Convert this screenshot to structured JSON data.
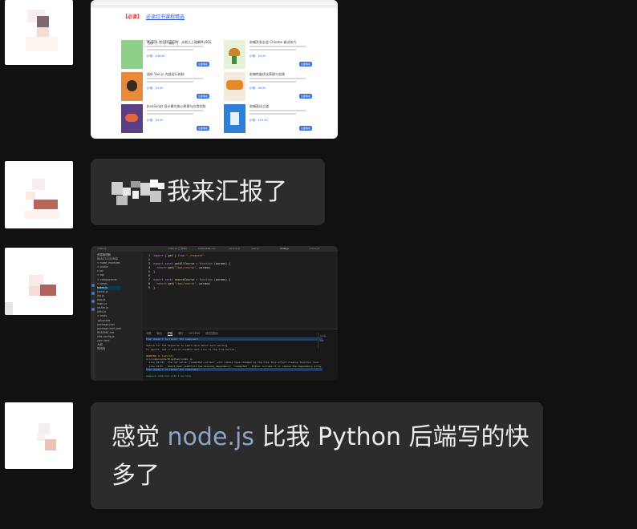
{
  "messages": [
    {
      "id": "msg1",
      "type": "image",
      "content": {
        "kind": "browser-course-list",
        "header_logo": "【必读】",
        "header_title": "必读红书课程精选",
        "filters": [
          "推荐",
          "全部",
          "课程"
        ],
        "courses": [
          {
            "title": "MySQL 是怎样运行的：从根儿上理解MySQL",
            "price": "价格：¥46.80"
          },
          {
            "title": "前端开发必会 Chrome 调试技巧",
            "price": "价格：¥9.90"
          },
          {
            "title": "剖析 Vue.js 内部运行机制",
            "price": "价格：¥4.90"
          },
          {
            "title": "前端性能优化原理与实践",
            "price": "价格：¥6.90"
          },
          {
            "title": "JavaScript 设计模式核心原理与应用实践",
            "price": "价格：¥9.90"
          },
          {
            "title": "前端面试之道",
            "price": "价格：¥19.90"
          }
        ],
        "button_label": "立即购买"
      }
    },
    {
      "id": "msg2",
      "type": "text",
      "text": "我来汇报了"
    },
    {
      "id": "msg3",
      "type": "image",
      "content": {
        "kind": "code-editor",
        "tabs": [
          "index.js",
          "index.js (工作树)",
          "EXPLORER.md",
          "service.js",
          "user.js",
          "node.js",
          "course.js"
        ],
        "tree": [
          "资源管理器",
          "REACT-COURSE",
          "> node_modules",
          "> public",
          "v src",
          "  > api",
          "  > components",
          "  v views",
          "    index.js",
          "    home.js",
          "    list.js",
          "  App.js",
          "  main.js",
          "  router.js",
          "  utils.js",
          "> tests",
          ".gitignore",
          "package.json",
          "package-lock.json",
          "README.md",
          "vite.config.js",
          "yarn.lock",
          "大纲",
          "时间线"
        ],
        "code": [
          "import { get } from \"./request\"",
          "",
          "export const getAllCourse = function (params) {",
          "  return get(\"/api/course\", params)",
          "}",
          "",
          "export const searchCourse = function (params) {",
          "  return get(\"/api/search\", params)",
          "}"
        ],
        "panel_tabs": [
          "问题",
          "输出",
          "终端",
          "端口",
          "GITLENS",
          "调试控制台"
        ],
        "terminal": [
          "than doesn't re-render the component.",
          "",
          "Search for the keywords to learn more about each warning.",
          "To ignore, add // eslint-disable-next-line to the line before.",
          "",
          "WARNING in [eslint]",
          "src/components/BlogItem/index.js",
          "  Line 10:36:  The ref value 'renderRef.current' will likely have changed by the time this effect cleanup function runs.",
          "  Line 12:5:   React Hook useEffect has missing dependency: 'renderRef'. Either include it or remove the dependency array.",
          "than doesn't re-render the component.",
          "",
          "webpack compiled with 1 warning"
        ],
        "panel_right": [
          "node",
          "zsh"
        ]
      }
    },
    {
      "id": "msg4",
      "type": "text",
      "text_before": "感觉 ",
      "link": "node.js",
      "text_after": " 比我 Python 后端写的快多了"
    }
  ]
}
